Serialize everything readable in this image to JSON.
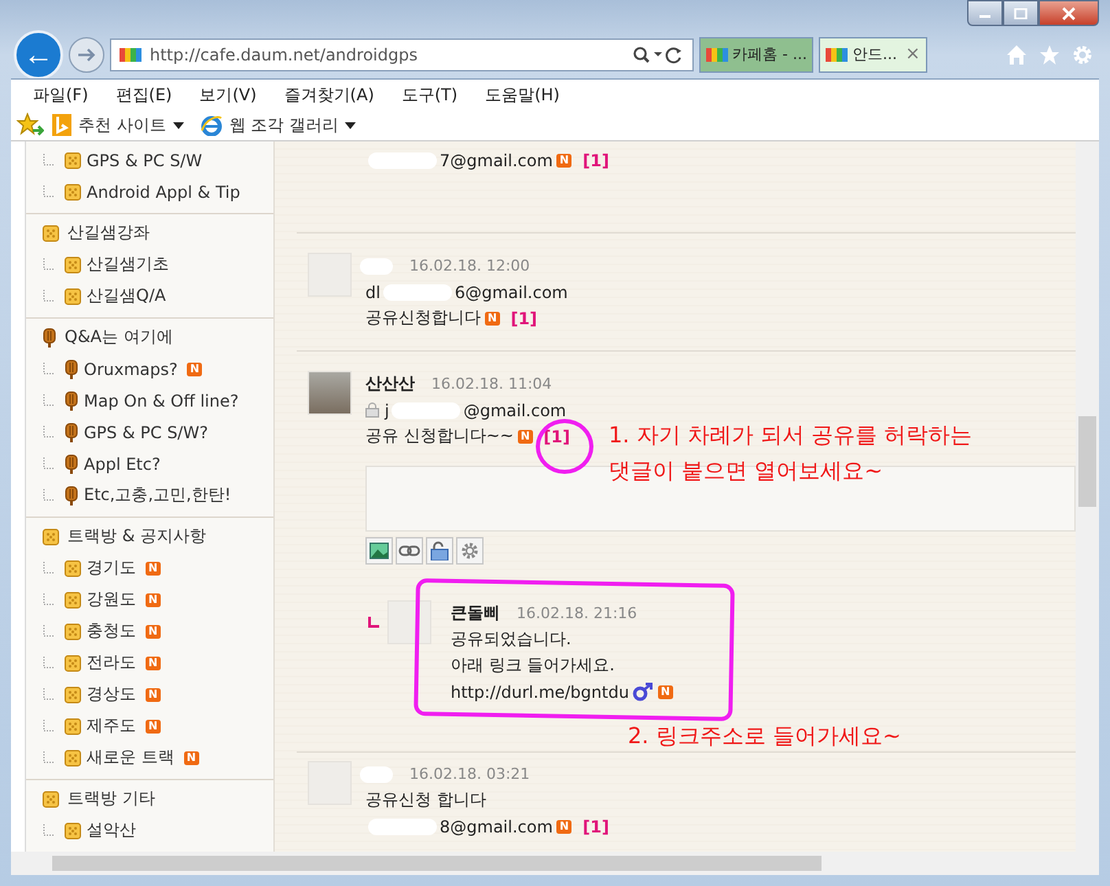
{
  "browser": {
    "back": "←",
    "address": "http://cafe.daum.net/androidgps",
    "tabs": [
      {
        "label": "카페홈 - ...",
        "selected": false
      },
      {
        "label": "안드...",
        "selected": true,
        "close": "×"
      }
    ]
  },
  "menu": [
    "파일(F)",
    "편집(E)",
    "보기(V)",
    "즐겨찾기(A)",
    "도구(T)",
    "도움말(H)"
  ],
  "favorites": [
    "추천 사이트",
    "웹 조각 갤러리"
  ],
  "sidebar": {
    "groups": [
      {
        "children": [
          {
            "label": "GPS & PC S/W",
            "kind": "board"
          },
          {
            "label": "Android Appl & Tip",
            "kind": "board"
          }
        ]
      },
      {
        "label": "산길샘강좌",
        "kind": "board",
        "children": [
          {
            "label": "산길샘기초",
            "kind": "board"
          },
          {
            "label": "산길샘Q/A",
            "kind": "board"
          }
        ]
      },
      {
        "label": "Q&A는 여기에",
        "kind": "qa",
        "children": [
          {
            "label": "Oruxmaps?",
            "kind": "qa",
            "badge": "N"
          },
          {
            "label": "Map On & Off line?",
            "kind": "qa"
          },
          {
            "label": "GPS & PC S/W?",
            "kind": "qa"
          },
          {
            "label": "Appl Etc?",
            "kind": "qa"
          },
          {
            "label": "Etc,고충,고민,한탄!",
            "kind": "qa"
          }
        ]
      },
      {
        "label": "트랙방 & 공지사항",
        "kind": "board",
        "children": [
          {
            "label": "경기도",
            "kind": "board",
            "badge": "N"
          },
          {
            "label": "강원도",
            "kind": "board",
            "badge": "N"
          },
          {
            "label": "충청도",
            "kind": "board",
            "badge": "N"
          },
          {
            "label": "전라도",
            "kind": "board",
            "badge": "N"
          },
          {
            "label": "경상도",
            "kind": "board",
            "badge": "N"
          },
          {
            "label": "제주도",
            "kind": "board",
            "badge": "N"
          },
          {
            "label": "새로운 트랙",
            "kind": "board",
            "badge": "N"
          }
        ]
      },
      {
        "label": "트랙방 기타",
        "kind": "board",
        "children": [
          {
            "label": "설악산",
            "kind": "board"
          }
        ]
      }
    ]
  },
  "comments": [
    {
      "kind": "cut",
      "lines": [
        {
          "kind": "email",
          "redacted": true,
          "rest": "7@gmail.com",
          "badge": "N",
          "count": "[1]"
        }
      ]
    },
    {
      "kind": "blank",
      "author_redacted": true,
      "date": "16.02.18. 12:00",
      "lines": [
        {
          "kind": "email",
          "text": "dl",
          "redacted": true,
          "rest": "6@gmail.com"
        },
        {
          "kind": "text",
          "text": "공유신청합니다",
          "badge": "N",
          "count": "[1]"
        }
      ]
    },
    {
      "kind": "photo",
      "author": "산산산",
      "date": "16.02.18. 11:04",
      "lines": [
        {
          "kind": "email",
          "text": "j",
          "redacted": true,
          "rest": "@gmail.com",
          "locked": true
        },
        {
          "kind": "text",
          "text": "공유 신청합니다~~",
          "badge": "N",
          "count": "[1]",
          "circled": true
        }
      ],
      "notes": [
        "1. 자기 차례가 되서 공유를 허락하는",
        "댓글이 붙으면 열어보세요~"
      ],
      "editor_open": true,
      "replies": [
        {
          "author": "큰돌삐",
          "date": "16.02.18. 21:16",
          "outlined": true,
          "note": "2. 링크주소로 들어가세요~",
          "lines": [
            {
              "kind": "text",
              "text": "공유되었습니다."
            },
            {
              "kind": "text",
              "text": "아래 링크 들어가세요."
            },
            {
              "kind": "link",
              "text": "http://durl.me/bgntdu",
              "badge": "N"
            }
          ]
        }
      ]
    },
    {
      "kind": "blank",
      "author_redacted": true,
      "date": "16.02.18. 03:21",
      "lines": [
        {
          "kind": "text",
          "text": "공유신청 합니다"
        },
        {
          "kind": "email",
          "redacted": true,
          "rest": "8@gmail.com",
          "badge": "N",
          "count": "[1]"
        }
      ]
    }
  ]
}
